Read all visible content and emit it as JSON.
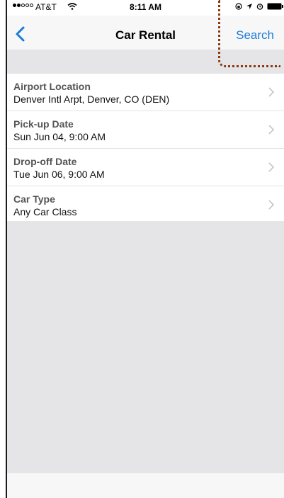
{
  "status_bar": {
    "carrier": "AT&T",
    "time": "8:11 AM",
    "signal_icon": "signal-dots-icon",
    "wifi_icon": "wifi-icon",
    "battery_icon": "battery-icon"
  },
  "nav": {
    "title": "Car Rental",
    "search_label": "Search",
    "back_icon": "chevron-left-icon",
    "accent_color": "#1b7bd6"
  },
  "form": {
    "rows": [
      {
        "label": "Airport Location",
        "value": "Denver Intl Arpt, Denver, CO (DEN)"
      },
      {
        "label": "Pick-up Date",
        "value": "Sun Jun 04, 9:00 AM"
      },
      {
        "label": "Drop-off Date",
        "value": "Tue Jun 06, 9:00 AM"
      },
      {
        "label": "Car Type",
        "value": "Any Car Class"
      }
    ]
  }
}
